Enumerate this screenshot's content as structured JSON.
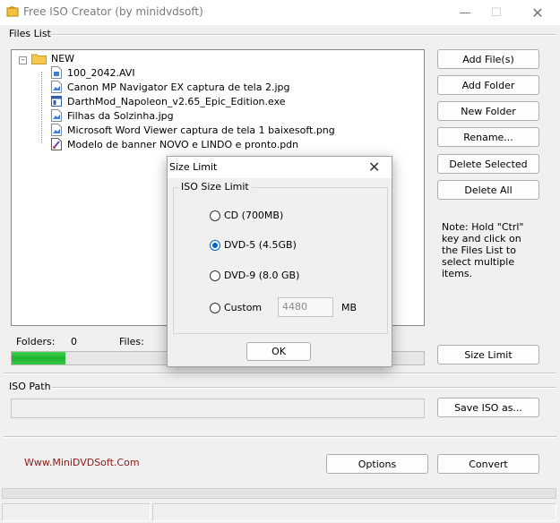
{
  "window": {
    "title": "Free ISO Creator (by minidvdsoft)"
  },
  "files_list": {
    "label": "Files List",
    "root": "NEW",
    "files": [
      {
        "name": "100_2042.AVI",
        "icon": "video-file-icon"
      },
      {
        "name": "Canon MP Navigator EX captura de tela 2.jpg",
        "icon": "image-file-icon"
      },
      {
        "name": "DarthMod_Napoleon_v2.65_Epic_Edition.exe",
        "icon": "exe-file-icon"
      },
      {
        "name": "Filhas da Solzinha.jpg",
        "icon": "image-file-icon"
      },
      {
        "name": "Microsoft Word Viewer captura de tela 1 baixesoft.png",
        "icon": "image-file-icon"
      },
      {
        "name": "Modelo de banner NOVO e LINDO e pronto.pdn",
        "icon": "paint-file-icon"
      }
    ]
  },
  "buttons": {
    "add_files": "Add File(s)",
    "add_folder": "Add Folder",
    "new_folder": "New Folder",
    "rename": "Rename...",
    "delete_selected": "Delete Selected",
    "delete_all": "Delete All",
    "size_limit": "Size Limit",
    "save_iso_as": "Save ISO as...",
    "options": "Options",
    "convert": "Convert"
  },
  "note": "Note: Hold \"Ctrl\" key and click on the Files List to select multiple items.",
  "stats": {
    "folders_label": "Folders:",
    "folders_value": "0",
    "files_label": "Files:"
  },
  "progress": {
    "fraction": 0.13
  },
  "iso_path": {
    "label": "ISO Path",
    "value": ""
  },
  "website": "Www.MiniDVDSoft.Com",
  "dialog": {
    "title": "Size Limit",
    "group_label": "ISO Size Limit",
    "options": [
      {
        "label": "CD (700MB)",
        "selected": false
      },
      {
        "label": "DVD-5 (4.5GB)",
        "selected": true
      },
      {
        "label": "DVD-9 (8.0 GB)",
        "selected": false
      },
      {
        "label": "Custom",
        "selected": false
      }
    ],
    "custom_value": "4480",
    "custom_unit": "MB",
    "ok": "OK"
  },
  "colors": {
    "progress": "#1fb22f",
    "link": "#8b1a1a",
    "radio_selected": "#0067c0"
  }
}
